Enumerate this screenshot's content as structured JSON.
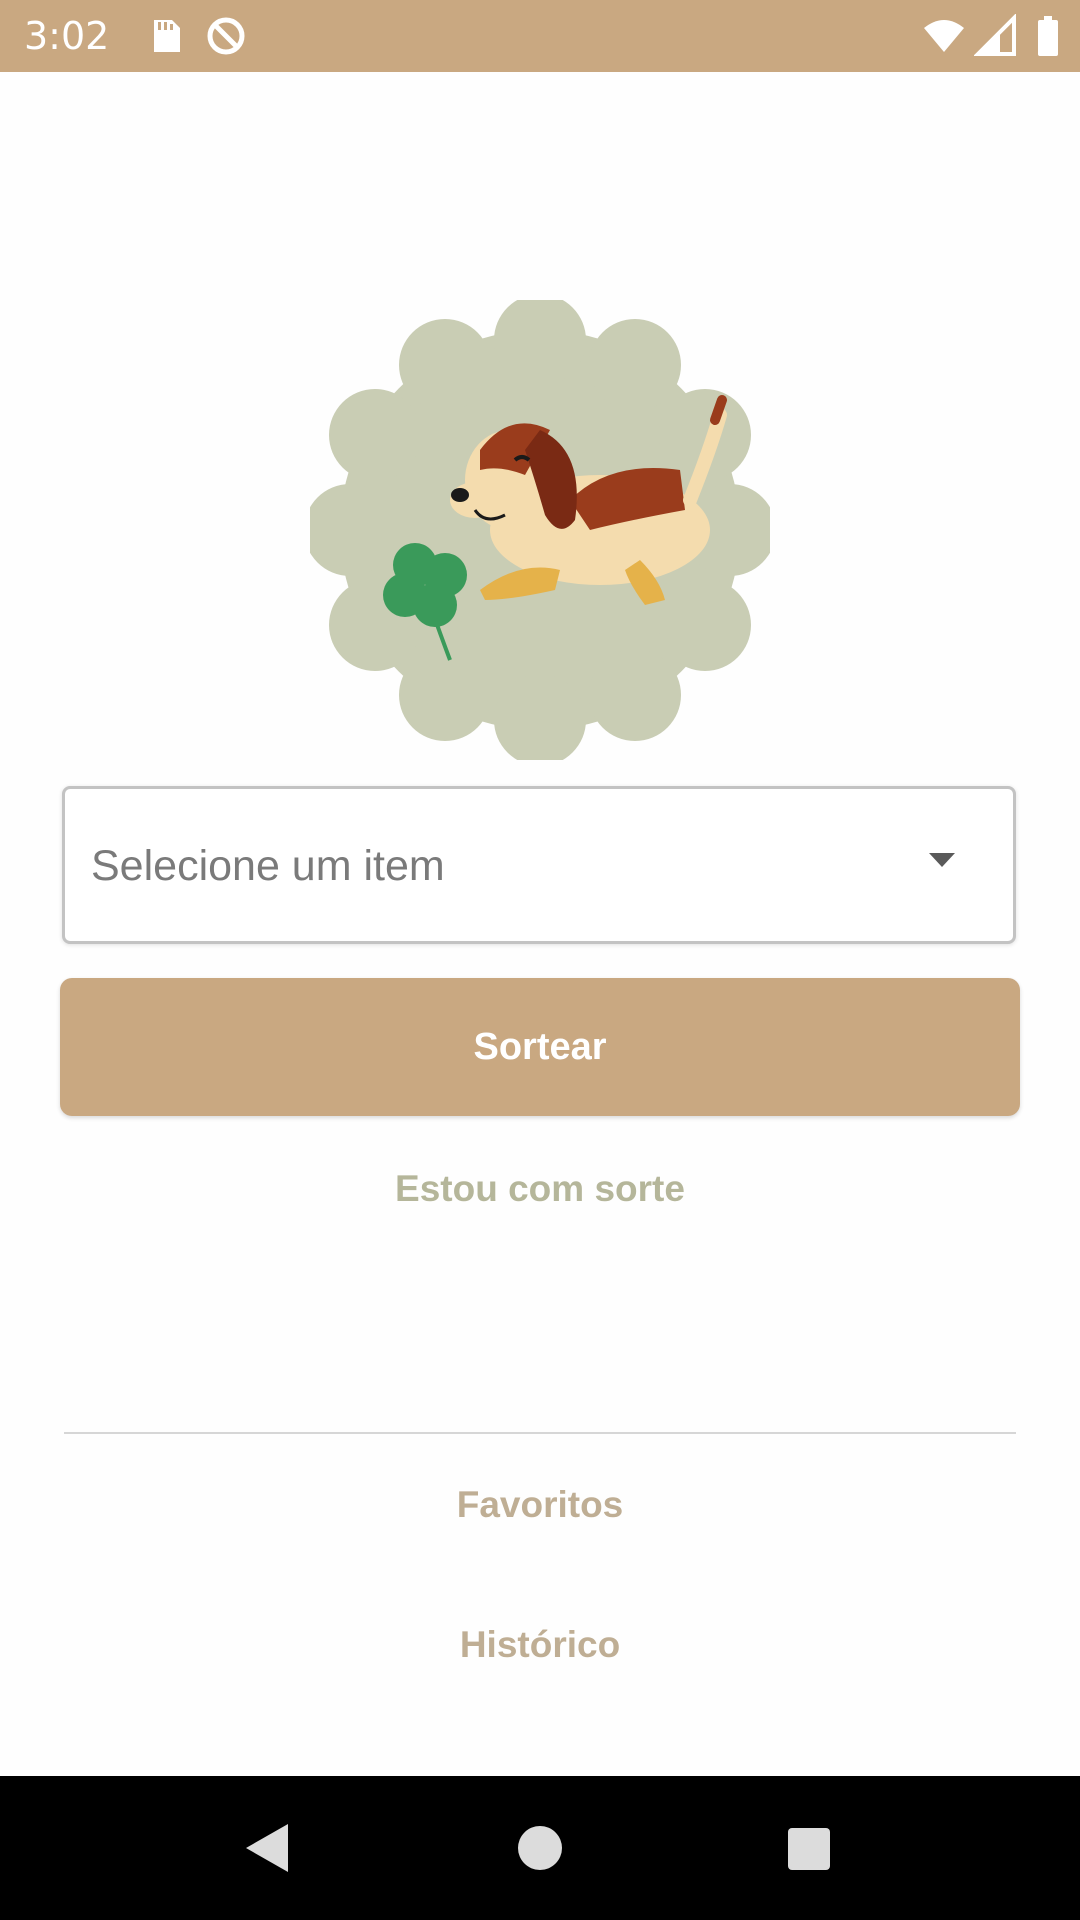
{
  "status_bar": {
    "time": "3:02",
    "background_color": "#c9a881",
    "icons": [
      "sd-card-icon",
      "no-sync-icon",
      "wifi-icon",
      "signal-icon",
      "battery-icon"
    ]
  },
  "logo": {
    "icon": "dog-with-clover-logo"
  },
  "form": {
    "dropdown_placeholder": "Selecione um item",
    "draw_button_label": "Sortear",
    "lucky_link_label": "Estou com sorte"
  },
  "menu": {
    "favorites_label": "Favoritos",
    "history_label": "Histórico"
  },
  "navigation_bar": {
    "icons": [
      "back-icon",
      "home-icon",
      "recents-icon"
    ]
  },
  "colors": {
    "accent": "#c9a881",
    "link_text": "#bfae94",
    "logo_background": "#c9cdb4"
  }
}
